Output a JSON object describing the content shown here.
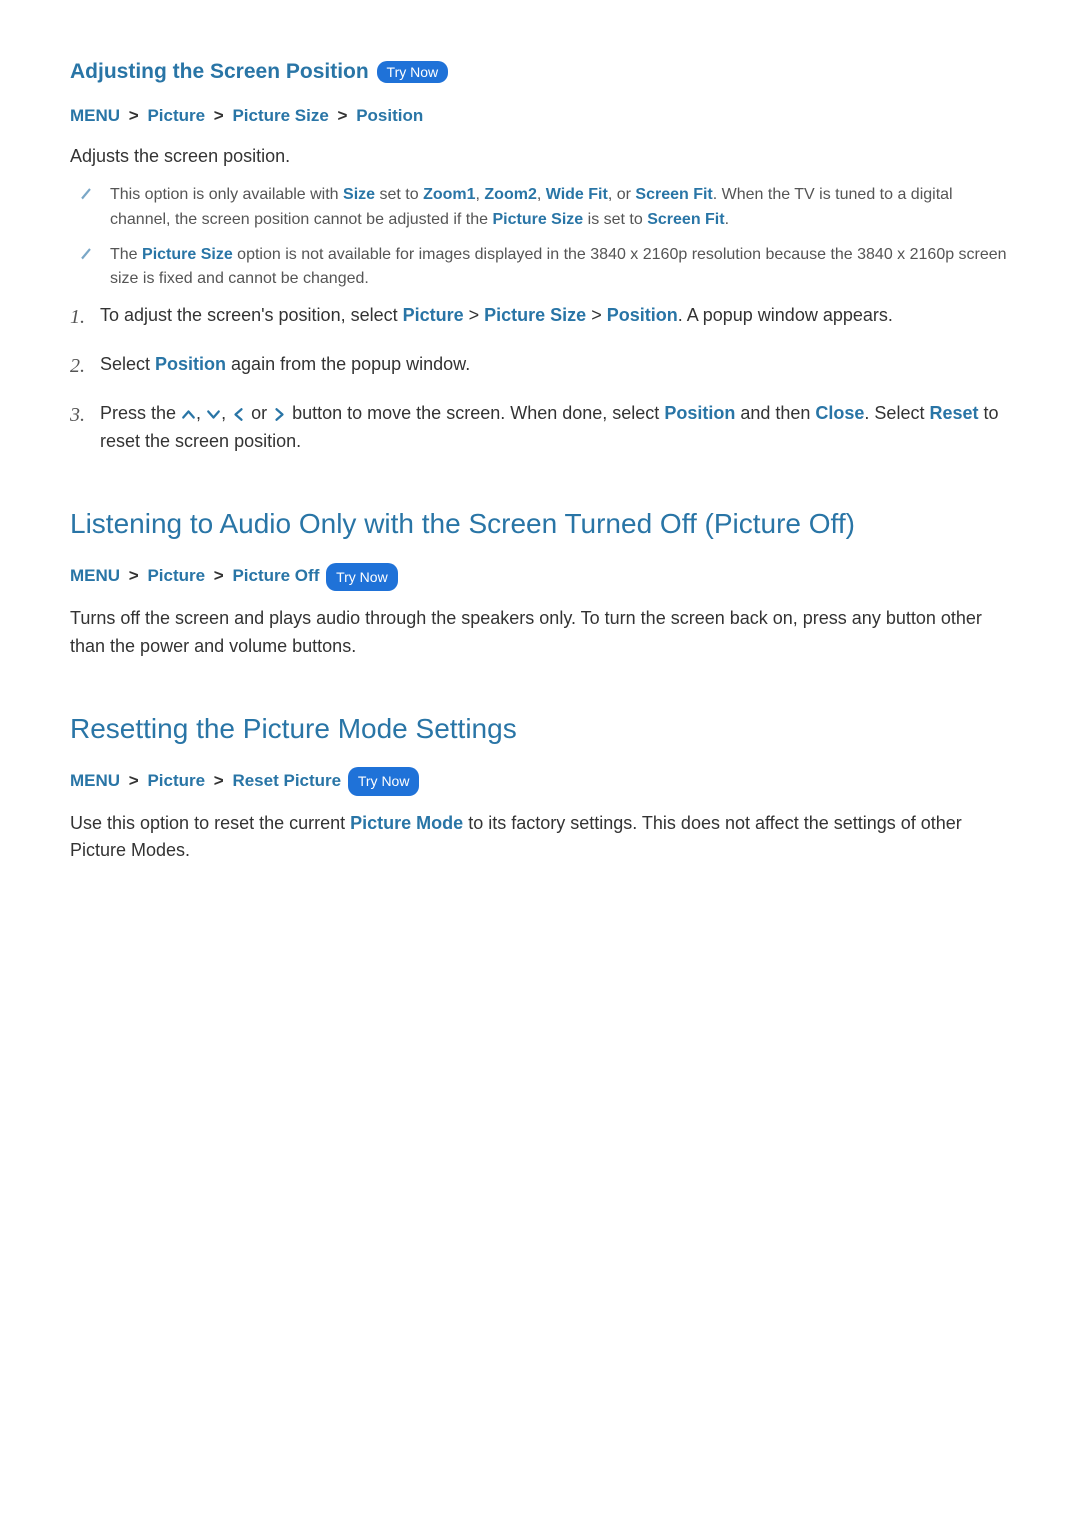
{
  "labels": {
    "try_now": "Try Now"
  },
  "section1": {
    "heading": "Adjusting the Screen Position",
    "breadcrumb": [
      "MENU",
      "Picture",
      "Picture Size",
      "Position"
    ],
    "intro": "Adjusts the screen position.",
    "notes": [
      {
        "parts": [
          {
            "t": "This option is only available with "
          },
          {
            "t": "Size",
            "link": true
          },
          {
            "t": " set to "
          },
          {
            "t": "Zoom1",
            "link": true
          },
          {
            "t": ", "
          },
          {
            "t": "Zoom2",
            "link": true
          },
          {
            "t": ", "
          },
          {
            "t": "Wide Fit",
            "link": true
          },
          {
            "t": ", or "
          },
          {
            "t": "Screen Fit",
            "link": true
          },
          {
            "t": ". When the TV is tuned to a digital channel, the screen position cannot be adjusted if the "
          },
          {
            "t": "Picture Size",
            "link": true
          },
          {
            "t": " is set to "
          },
          {
            "t": "Screen Fit",
            "link": true
          },
          {
            "t": "."
          }
        ]
      },
      {
        "parts": [
          {
            "t": "The "
          },
          {
            "t": "Picture Size",
            "link": true
          },
          {
            "t": " option is not available for images displayed in the 3840 x 2160p resolution because the 3840 x 2160p screen size is fixed and cannot be changed."
          }
        ]
      }
    ],
    "steps": [
      {
        "parts": [
          {
            "t": "To adjust the screen's position, select "
          },
          {
            "t": "Picture",
            "link": true
          },
          {
            "sep": true
          },
          {
            "t": "Picture Size",
            "link": true
          },
          {
            "sep": true
          },
          {
            "t": "Position",
            "link": true
          },
          {
            "t": ". A popup window appears."
          }
        ]
      },
      {
        "parts": [
          {
            "t": "Select "
          },
          {
            "t": "Position",
            "link": true
          },
          {
            "t": " again from the popup window."
          }
        ]
      },
      {
        "parts": [
          {
            "t": "Press the "
          },
          {
            "arrow": "up"
          },
          {
            "t": ", "
          },
          {
            "arrow": "down"
          },
          {
            "t": ", "
          },
          {
            "arrow": "left"
          },
          {
            "t": " or "
          },
          {
            "arrow": "right"
          },
          {
            "t": " button to move the screen. When done, select "
          },
          {
            "t": "Position",
            "link": true
          },
          {
            "t": " and then "
          },
          {
            "t": "Close",
            "link": true
          },
          {
            "t": ". Select "
          },
          {
            "t": "Reset",
            "link": true
          },
          {
            "t": " to reset the screen position."
          }
        ]
      }
    ]
  },
  "section2": {
    "heading": "Listening to Audio Only with the Screen Turned Off (Picture Off)",
    "breadcrumb": [
      "MENU",
      "Picture",
      "Picture Off"
    ],
    "body": "Turns off the screen and plays audio through the speakers only. To turn the screen back on, press any button other than the power and volume buttons."
  },
  "section3": {
    "heading": "Resetting the Picture Mode Settings",
    "breadcrumb": [
      "MENU",
      "Picture",
      "Reset Picture"
    ],
    "body_parts": [
      {
        "t": "Use this option to reset the current "
      },
      {
        "t": "Picture Mode",
        "link": true
      },
      {
        "t": " to its factory settings. This does not affect the settings of other Picture Modes."
      }
    ]
  }
}
